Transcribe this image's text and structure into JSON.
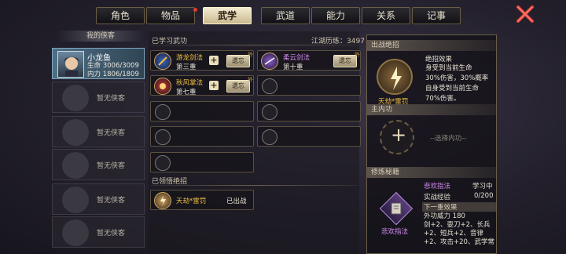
{
  "tabs": [
    {
      "label": "角色",
      "active": false,
      "dot": false
    },
    {
      "label": "物品",
      "active": false,
      "dot": true
    },
    {
      "label": "武学",
      "active": true,
      "dot": false
    },
    {
      "label": "武道",
      "active": false,
      "dot": false
    },
    {
      "label": "能力",
      "active": false,
      "dot": false
    },
    {
      "label": "关系",
      "active": false,
      "dot": false
    },
    {
      "label": "记事",
      "active": false,
      "dot": false
    }
  ],
  "left": {
    "header": "我的侠客",
    "selected": {
      "name": "小龙鱼",
      "hp_label": "生命",
      "hp": "3006/3009",
      "mp_label": "内力",
      "mp": "1806/1809"
    },
    "empty_label": "暂无侠客"
  },
  "learned": {
    "title": "已学习武功",
    "exp_label": "江湖历练：",
    "exp_value": "3497",
    "forget_label": "遗忘",
    "tag": "外",
    "skills": [
      {
        "name": "游龙剑法",
        "level": "第三重",
        "color": "gold",
        "has_plus": true
      },
      {
        "name": "柔云剑法",
        "level": "第十重",
        "color": "purple",
        "has_plus": false
      },
      {
        "name": "秋风掌法",
        "level": "第七重",
        "color": "gold",
        "has_plus": true
      }
    ]
  },
  "comprehended": {
    "title": "已领悟绝招",
    "name": "天劫*雷罚",
    "status": "已出战"
  },
  "right": {
    "battle_header": "出战绝招",
    "battle_name": "天劫*雷罚",
    "effect_title": "绝招效果",
    "effect_lines": [
      "身受到当前生命",
      "30%伤害，30%概率",
      "自身受到当前生命",
      "70%伤害。"
    ],
    "inner_header": "主内功",
    "inner_placeholder": "--选择内功--",
    "secret_header": "修炼秘籍",
    "book_name": "悲欢指法",
    "book_status": "学习中",
    "exp_label": "实战经验",
    "exp_value": "0/200",
    "next_label": "下一重效果",
    "next_lines": [
      "外功威力 180",
      "剑+2、耍刀+2、长兵",
      "+2、短兵+2、音律",
      "+2、攻击+20、武学常"
    ]
  },
  "colors": {
    "accent": "#f0c040",
    "purple": "#d38cf2",
    "active_tab": "#e8ddbd"
  }
}
